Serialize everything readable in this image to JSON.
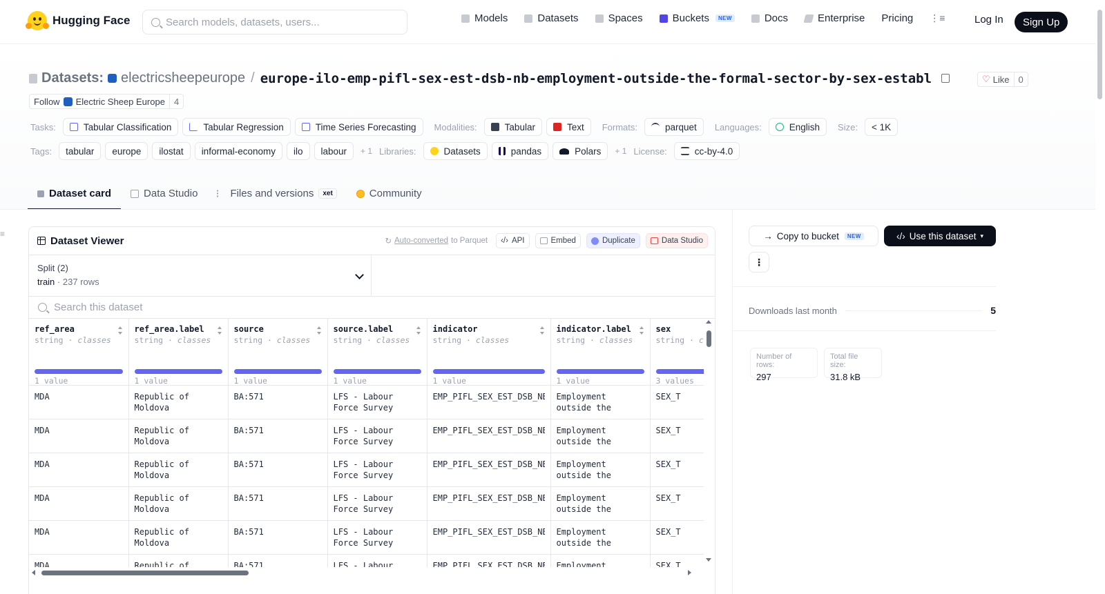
{
  "header": {
    "brand": "Hugging Face",
    "search_placeholder": "Search models, datasets, users...",
    "nav": [
      {
        "label": "Models",
        "icon": "cube-icon",
        "color": "#9ca3af"
      },
      {
        "label": "Datasets",
        "icon": "database-icon",
        "color": "#9ca3af"
      },
      {
        "label": "Spaces",
        "icon": "grid-icon",
        "color": "#9ca3af"
      },
      {
        "label": "Buckets",
        "icon": "bucket-icon",
        "color": "#4f46e5",
        "badge": "NEW"
      },
      {
        "label": "Docs",
        "icon": "book-icon",
        "color": "#9ca3af"
      },
      {
        "label": "Enterprise",
        "icon": "enterprise-icon",
        "color": "#9ca3af"
      },
      {
        "label": "Pricing"
      }
    ],
    "login": "Log In",
    "signup": "Sign Up"
  },
  "repo": {
    "type_label": "Datasets:",
    "org": "electricsheepeurope",
    "name": "europe-ilo-emp-pifl-sex-est-dsb-nb-employment-outside-the-formal-sector-by-sex-establ",
    "like_label": "Like",
    "like_count": "0",
    "follow_label": "Follow",
    "follow_org": "Electric Sheep Europe",
    "follow_count": "4"
  },
  "meta": {
    "tasks_label": "Tasks:",
    "tasks": [
      "Tabular Classification",
      "Tabular Regression",
      "Time Series Forecasting"
    ],
    "modalities_label": "Modalities:",
    "modalities": [
      "Tabular",
      "Text"
    ],
    "formats_label": "Formats:",
    "formats": [
      "parquet"
    ],
    "languages_label": "Languages:",
    "languages": [
      "English"
    ],
    "size_label": "Size:",
    "size": "< 1K",
    "tags_label": "Tags:",
    "tags": [
      "tabular",
      "europe",
      "ilostat",
      "informal-economy",
      "ilo",
      "labour"
    ],
    "tags_more": "+ 1",
    "libraries_label": "Libraries:",
    "libraries": [
      "Datasets",
      "pandas",
      "Polars"
    ],
    "libraries_more": "+ 1",
    "license_label": "License:",
    "license": "cc-by-4.0"
  },
  "tabs": [
    {
      "label": "Dataset card",
      "active": true
    },
    {
      "label": "Data Studio"
    },
    {
      "label": "Files and versions",
      "badge": "xet"
    },
    {
      "label": "Community"
    }
  ],
  "viewer": {
    "title": "Dataset Viewer",
    "auto_converted": "Auto-converted",
    "to_parquet": "to Parquet",
    "api": "API",
    "embed": "Embed",
    "duplicate": "Duplicate",
    "data_studio": "Data Studio",
    "split_label": "Split (2)",
    "split_value": "train",
    "split_sep": "·",
    "split_rows": "237 rows",
    "search_placeholder": "Search this dataset",
    "columns": [
      {
        "name": "ref_area",
        "type": "string",
        "kind": "classes",
        "count": "1 value"
      },
      {
        "name": "ref_area.label",
        "type": "string",
        "kind": "classes",
        "count": "1 value"
      },
      {
        "name": "source",
        "type": "string",
        "kind": "classes",
        "count": "1 value"
      },
      {
        "name": "source.label",
        "type": "string",
        "kind": "classes",
        "count": "1 value"
      },
      {
        "name": "indicator",
        "type": "string",
        "kind": "classes",
        "count": "1 value"
      },
      {
        "name": "indicator.label",
        "type": "string",
        "kind": "classes",
        "count": "1 value"
      },
      {
        "name": "sex",
        "type": "string",
        "kind": "classes",
        "count": "3 values"
      }
    ],
    "rows": [
      [
        "MDA",
        "Republic of Moldova",
        "BA:571",
        "LFS - Labour Force Survey",
        "EMP_PIFL_SEX_EST_DSB_NB",
        "Employment outside the formal sector…",
        "SEX_T"
      ],
      [
        "MDA",
        "Republic of Moldova",
        "BA:571",
        "LFS - Labour Force Survey",
        "EMP_PIFL_SEX_EST_DSB_NB",
        "Employment outside the formal sector…",
        "SEX_T"
      ],
      [
        "MDA",
        "Republic of Moldova",
        "BA:571",
        "LFS - Labour Force Survey",
        "EMP_PIFL_SEX_EST_DSB_NB",
        "Employment outside the formal sector…",
        "SEX_T"
      ],
      [
        "MDA",
        "Republic of Moldova",
        "BA:571",
        "LFS - Labour Force Survey",
        "EMP_PIFL_SEX_EST_DSB_NB",
        "Employment outside the formal sector…",
        "SEX_T"
      ],
      [
        "MDA",
        "Republic of Moldova",
        "BA:571",
        "LFS - Labour Force Survey",
        "EMP_PIFL_SEX_EST_DSB_NB",
        "Employment outside the formal sector…",
        "SEX_T"
      ],
      [
        "MDA",
        "Republic of Moldova",
        "BA:571",
        "LFS - Labour Force Survey",
        "EMP_PIFL_SEX_EST_DSB_NB",
        "Employment outside the formal sector…",
        "SEX_T"
      ]
    ]
  },
  "sidebar": {
    "copy_bucket": "Copy to bucket",
    "copy_badge": "NEW",
    "use_dataset": "Use this dataset",
    "downloads_label": "Downloads last month",
    "downloads": "5",
    "rows_label": "Number of rows:",
    "rows": "297",
    "size_label": "Total file size:",
    "size": "31.8 kB"
  }
}
